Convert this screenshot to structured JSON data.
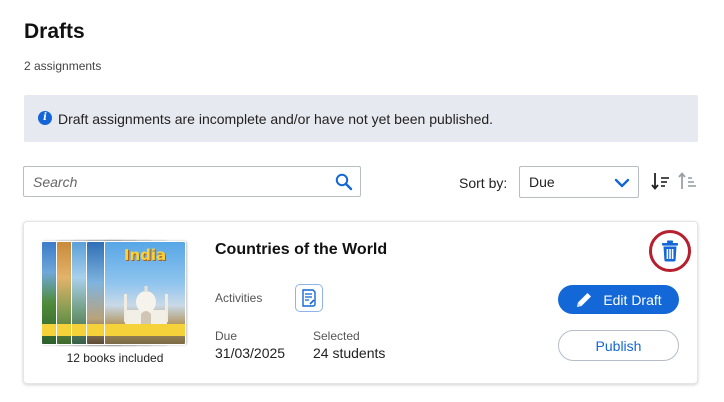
{
  "header": {
    "title": "Drafts",
    "count": "2 assignments"
  },
  "info_banner": {
    "icon": "info-icon",
    "text": "Draft assignments are incomplete and/or have not yet been published."
  },
  "search": {
    "placeholder": "Search",
    "value": ""
  },
  "sort": {
    "label": "Sort by:",
    "selected": "Due",
    "icons": [
      "sort-descending-icon",
      "sort-ascending-icon"
    ]
  },
  "assignments": [
    {
      "title": "Countries of the World",
      "books_caption": "12 books included",
      "cover_title": "India",
      "activities_label": "Activities",
      "due_label": "Due",
      "due_value": "31/03/2025",
      "selected_label": "Selected",
      "selected_value": "24 students",
      "edit_label": "Edit Draft",
      "publish_label": "Publish"
    }
  ],
  "colors": {
    "accent": "#1467d6",
    "banner_bg": "#e6e9ef",
    "highlight_ring": "#b51f2e"
  }
}
